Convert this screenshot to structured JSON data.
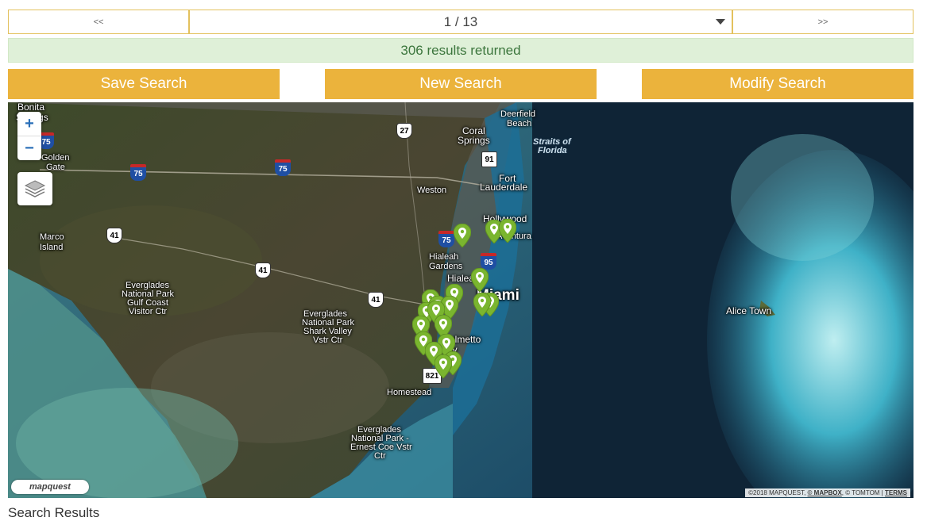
{
  "pager": {
    "prev_label": "<<",
    "next_label": ">>",
    "page_display": "1 / 13"
  },
  "results": {
    "summary": "306 results returned"
  },
  "actions": {
    "save_label": "Save Search",
    "new_label": "New Search",
    "modify_label": "Modify Search"
  },
  "map": {
    "zoom_in": "+",
    "zoom_out": "−",
    "logo": "mapquest",
    "attribution": {
      "copyright": "©2018 MAPQUEST,",
      "mapbox": "© MAPBOX",
      "tomtom": ", © TOMTOM |",
      "terms": "TERMS"
    },
    "labels": {
      "bonita": "Bonita",
      "springs": "Springs",
      "golden": "Golden",
      "gate": "Gate",
      "deerfield": "Deerfield",
      "beach": "Beach",
      "coral": "Coral",
      "coral_springs": "Springs",
      "straits1": "Straits of",
      "straits2": "Florida",
      "fort": "Fort",
      "lauderdale": "Lauderdale",
      "weston": "Weston",
      "hollywood": "Hollywood",
      "aventura": "Aventura",
      "marco": "Marco",
      "island": "Island",
      "hialeah_gardens1": "Hialeah",
      "hialeah_gardens2": "Gardens",
      "hialeah": "Hialeah",
      "miami": "Miami",
      "eg_gulf1": "Everglades",
      "eg_gulf2": "National Park",
      "eg_gulf3": "Gulf Coast",
      "eg_gulf4": "Visitor Ctr",
      "eg_shark1": "Everglades",
      "eg_shark2": "National Park",
      "eg_shark3": "Shark Valley",
      "eg_shark4": "Vstr Ctr",
      "palmetto": "Palmetto",
      "bay": "Bay",
      "homestead": "Homestead",
      "eg_coe1": "Everglades",
      "eg_coe2": "National Park -",
      "eg_coe3": "Ernest Coe Vstr",
      "eg_coe4": "Ctr",
      "alice": "Alice Town"
    },
    "shields": {
      "i75a": "75",
      "i75b": "75",
      "i75c": "75",
      "i75d": "75",
      "i95": "95",
      "us27": "27",
      "us41a": "41",
      "us41b": "41",
      "us41c": "41",
      "fl91": "91",
      "fl821": "821"
    },
    "marker_color": "#7ab52f"
  },
  "footer": {
    "section_title": "Search Results"
  }
}
